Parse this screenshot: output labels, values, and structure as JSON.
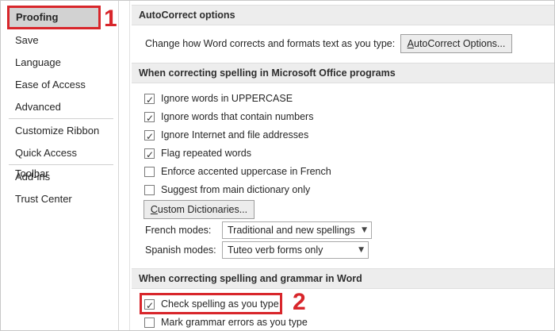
{
  "sidebar": {
    "items": [
      {
        "label": "Proofing",
        "selected": true
      },
      {
        "label": "Save"
      },
      {
        "label": "Language"
      },
      {
        "label": "Ease of Access"
      },
      {
        "label": "Advanced"
      },
      {
        "label": "Customize Ribbon"
      },
      {
        "label": "Quick Access Toolbar"
      },
      {
        "label": "Add-ins"
      },
      {
        "label": "Trust Center"
      }
    ]
  },
  "annotations": {
    "one": "1",
    "two": "2",
    "color": "#d8262b"
  },
  "autocorrect": {
    "header": "AutoCorrect options",
    "description": "Change how Word corrects and formats text as you type:",
    "button_prefix": "A",
    "button_rest": "utoCorrect Options..."
  },
  "office_spelling": {
    "header": "When correcting spelling in Microsoft Office programs",
    "options": [
      {
        "label": "Ignore words in UPPERCASE",
        "checked": true
      },
      {
        "label": "Ignore words that contain numbers",
        "checked": true
      },
      {
        "label": "Ignore Internet and file addresses",
        "checked": true
      },
      {
        "label": "Flag repeated words",
        "checked": true
      },
      {
        "label": "Enforce accented uppercase in French",
        "checked": false
      },
      {
        "label": "Suggest from main dictionary only",
        "checked": false
      }
    ],
    "custom_dict_prefix": "C",
    "custom_dict_rest": "ustom Dictionaries...",
    "french_modes_label": "French modes:",
    "french_modes_value": "Traditional and new spellings",
    "spanish_modes_label": "Spanish modes:",
    "spanish_modes_value": "Tuteo verb forms only"
  },
  "word_spelling": {
    "header": "When correcting spelling and grammar in Word",
    "options": [
      {
        "label": "Check spelling as you type",
        "checked": true
      },
      {
        "label": "Mark grammar errors as you type",
        "checked": false
      }
    ]
  }
}
